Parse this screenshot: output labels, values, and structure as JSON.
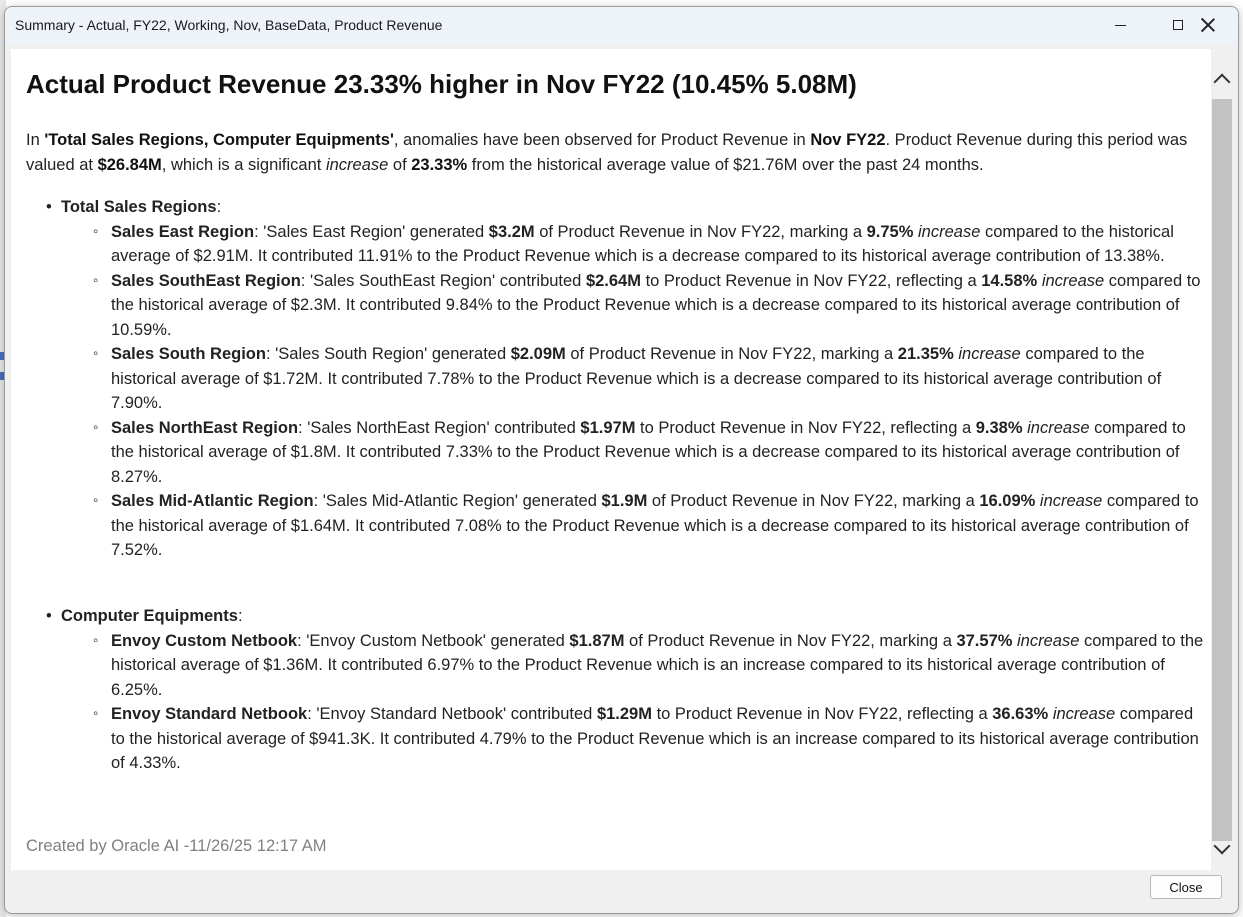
{
  "window": {
    "title": "Summary - Actual, FY22, Working, Nov, BaseData, Product Revenue",
    "close_button_label": "Close"
  },
  "headline": "Actual Product Revenue 23.33% higher in Nov FY22 (10.45% 5.08M)",
  "intro": {
    "t1": "In ",
    "b1": "'Total Sales Regions, Computer Equipments'",
    "t2": ", anomalies have been observed for Product Revenue in ",
    "b2": "Nov FY22",
    "t3": ". Product Revenue during this period was valued at ",
    "b3": "$26.84M",
    "t4": ", which is a significant ",
    "i1": "increase",
    "t5": " of ",
    "b4": "23.33%",
    "t6": " from the historical average value of $21.76M over the past 24 months."
  },
  "groups": [
    {
      "title": "Total Sales Regions",
      "items": [
        {
          "name": "Sales East Region",
          "pre": ": 'Sales East Region' generated ",
          "amount": "$3.2M",
          "mid": " of Product Revenue in Nov FY22, marking a ",
          "pct": "9.75%",
          "dir": "increase",
          "rest": " compared to the historical average of $2.91M. It contributed 11.91% to the Product Revenue which is a decrease compared to its historical average contribution of 13.38%."
        },
        {
          "name": "Sales SouthEast Region",
          "pre": ": 'Sales SouthEast Region' contributed ",
          "amount": "$2.64M",
          "mid": " to Product Revenue in Nov FY22, reflecting a ",
          "pct": "14.58%",
          "dir": "increase",
          "rest": " compared to the historical average of $2.3M. It contributed 9.84% to the Product Revenue which is a decrease compared to its historical average contribution of 10.59%."
        },
        {
          "name": "Sales South Region",
          "pre": ": 'Sales South Region' generated ",
          "amount": "$2.09M",
          "mid": " of Product Revenue in Nov FY22, marking a ",
          "pct": "21.35%",
          "dir": "increase",
          "rest": " compared to the historical average of $1.72M. It contributed 7.78% to the Product Revenue which is a decrease compared to its historical average contribution of 7.90%."
        },
        {
          "name": "Sales NorthEast Region",
          "pre": ": 'Sales NorthEast Region' contributed ",
          "amount": "$1.97M",
          "mid": " to Product Revenue in Nov FY22, reflecting a ",
          "pct": "9.38%",
          "dir": "increase",
          "rest": " compared to the historical average of $1.8M. It contributed 7.33% to the Product Revenue which is a decrease compared to its historical average contribution of 8.27%."
        },
        {
          "name": "Sales Mid-Atlantic Region",
          "pre": ": 'Sales Mid-Atlantic Region' generated ",
          "amount": "$1.9M",
          "mid": " of Product Revenue in Nov FY22, marking a ",
          "pct": "16.09%",
          "dir": "increase",
          "rest": " compared to the historical average of $1.64M. It contributed 7.08% to the Product Revenue which is a decrease compared to its historical average contribution of 7.52%."
        }
      ]
    },
    {
      "title": "Computer Equipments",
      "items": [
        {
          "name": "Envoy Custom Netbook",
          "pre": ": 'Envoy Custom Netbook' generated ",
          "amount": "$1.87M",
          "mid": " of Product Revenue in Nov FY22, marking a ",
          "pct": "37.57%",
          "dir": "increase",
          "rest": " compared to the historical average of $1.36M. It contributed 6.97% to the Product Revenue which is an increase compared to its historical average contribution of 6.25%."
        },
        {
          "name": "Envoy Standard Netbook",
          "pre": ": 'Envoy Standard Netbook' contributed ",
          "amount": "$1.29M",
          "mid": " to Product Revenue in Nov FY22, reflecting a ",
          "pct": "36.63%",
          "dir": "increase",
          "rest": " compared to the historical average of $941.3K. It contributed 4.79% to the Product Revenue which is an increase compared to its historical average contribution of 4.33%."
        }
      ]
    }
  ],
  "footer_credit": "Created by Oracle AI -11/26/25 12:17 AM",
  "icons": {
    "minimize": "minimize-icon",
    "maximize": "maximize-icon",
    "close": "close-icon",
    "scroll_up": "chevron-up-icon",
    "scroll_down": "chevron-down-icon"
  }
}
